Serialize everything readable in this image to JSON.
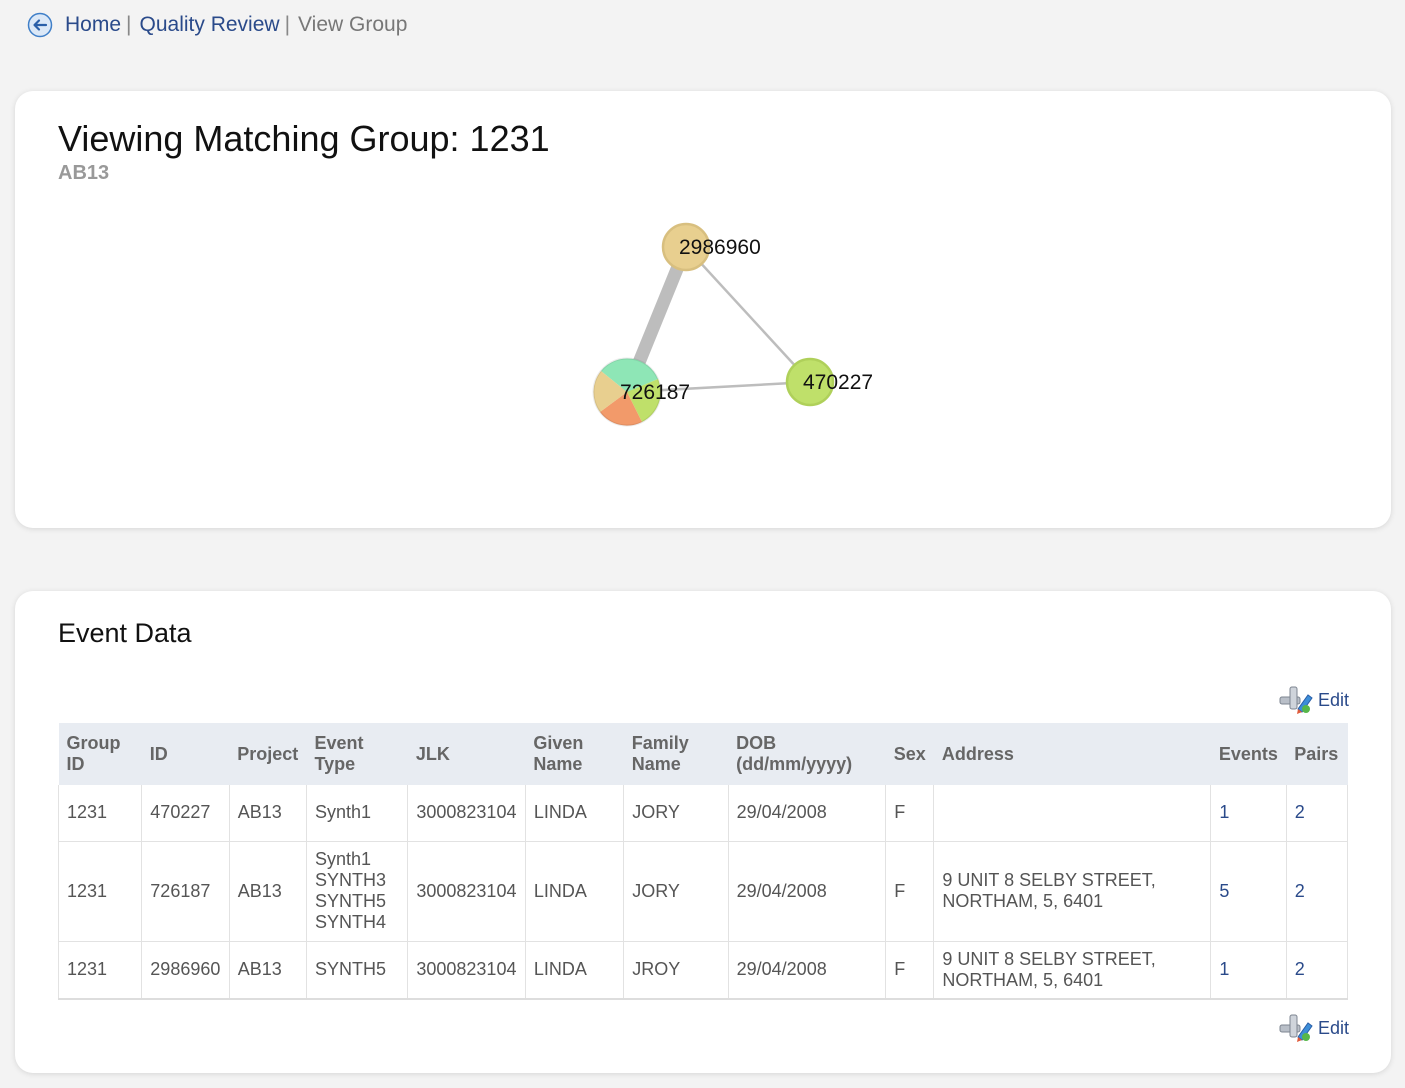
{
  "breadcrumb": {
    "home": "Home",
    "quality_review": "Quality Review",
    "current": "View Group",
    "separator": "|"
  },
  "group": {
    "title": "Viewing Matching Group: 1231",
    "project": "AB13"
  },
  "graph": {
    "nodes": [
      {
        "id": "2986960",
        "colors": [
          "#e8cf8f"
        ]
      },
      {
        "id": "726187",
        "colors": [
          "#8ee6b6",
          "#bfe06a",
          "#f29a6a",
          "#e8cf8f"
        ]
      },
      {
        "id": "470227",
        "colors": [
          "#bfe06a"
        ]
      }
    ],
    "edges": [
      {
        "from": "2986960",
        "to": "726187",
        "weight": "heavy"
      },
      {
        "from": "2986960",
        "to": "470227",
        "weight": "light"
      },
      {
        "from": "726187",
        "to": "470227",
        "weight": "light"
      }
    ]
  },
  "event_data": {
    "title": "Event Data",
    "edit_label": "Edit",
    "columns": [
      "Group ID",
      "ID",
      "Project",
      "Event Type",
      "JLK",
      "Given Name",
      "Family Name",
      "DOB (dd/mm/yyyy)",
      "Sex",
      "Address",
      "Events",
      "Pairs"
    ],
    "rows": [
      {
        "group_id": "1231",
        "id": "470227",
        "project": "AB13",
        "event_type": [
          "Synth1"
        ],
        "jlk": "3000823104",
        "given_name": "LINDA",
        "family_name": "JORY",
        "dob": "29/04/2008",
        "sex": "F",
        "address": [
          "",
          ""
        ],
        "events": "1",
        "pairs": "2"
      },
      {
        "group_id": "1231",
        "id": "726187",
        "project": "AB13",
        "event_type": [
          "Synth1",
          "SYNTH3",
          "SYNTH5",
          "SYNTH4"
        ],
        "jlk": "3000823104",
        "given_name": "LINDA",
        "family_name": "JORY",
        "dob": "29/04/2008",
        "sex": "F",
        "address": [
          "9 UNIT 8 SELBY STREET,",
          "NORTHAM, 5, 6401"
        ],
        "events": "5",
        "pairs": "2"
      },
      {
        "group_id": "1231",
        "id": "2986960",
        "project": "AB13",
        "event_type": [
          "SYNTH5"
        ],
        "jlk": "3000823104",
        "given_name": "LINDA",
        "family_name": "JROY",
        "dob": "29/04/2008",
        "sex": "F",
        "address": [
          "9 UNIT 8 SELBY STREET,",
          "NORTHAM, 5, 6401"
        ],
        "events": "1",
        "pairs": "2"
      }
    ]
  }
}
